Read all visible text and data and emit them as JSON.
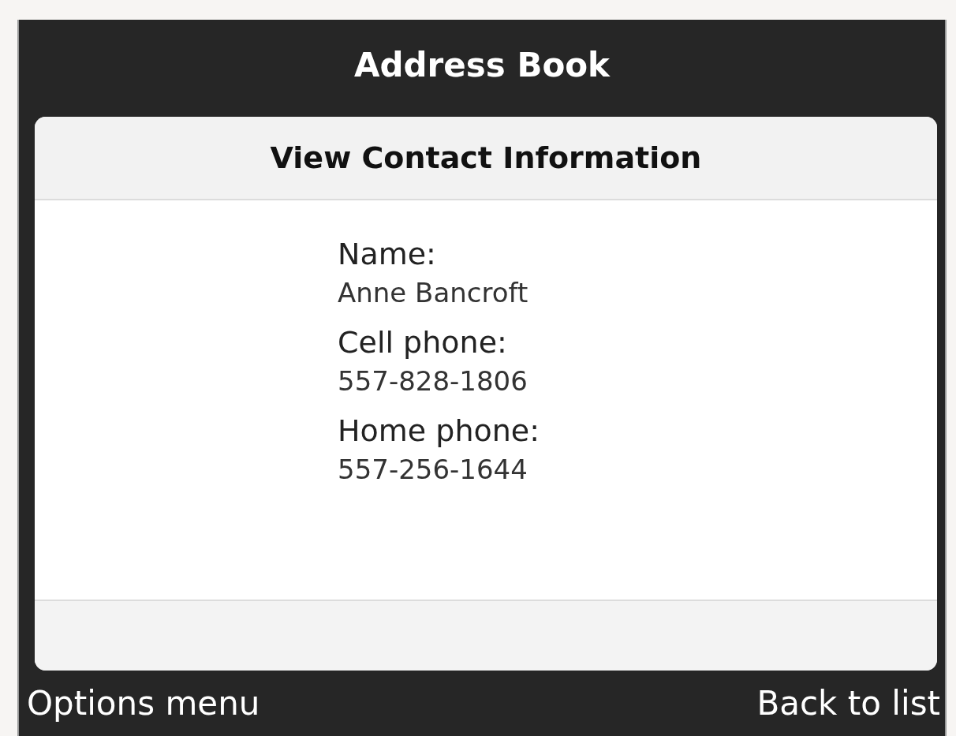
{
  "title_bar": {
    "title": "Address Book"
  },
  "card": {
    "heading": "View Contact Information",
    "fields": [
      {
        "label": "Name:",
        "value": "Anne Bancroft"
      },
      {
        "label": "Cell phone:",
        "value": "557-828-1806"
      },
      {
        "label": "Home phone:",
        "value": "557-256-1644"
      }
    ]
  },
  "softkeys": {
    "left": "Options menu",
    "right": "Back to list"
  }
}
